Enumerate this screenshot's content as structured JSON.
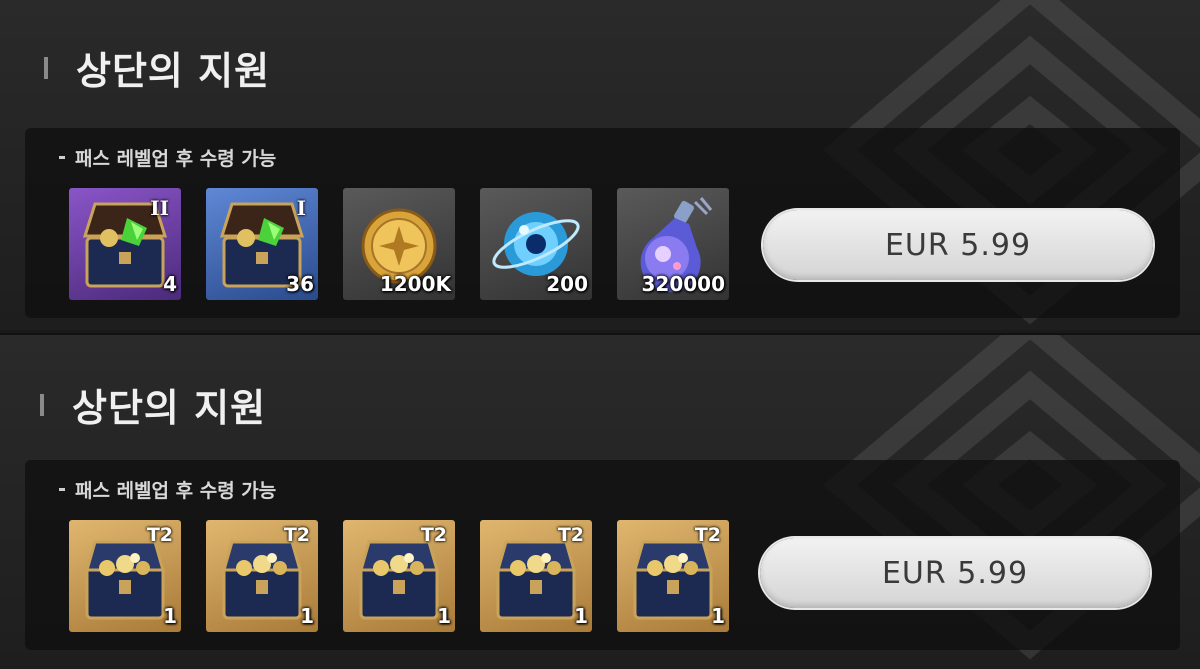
{
  "packs": [
    {
      "title": "상단의 지원",
      "note": "패스 레벨업 후 수령 가능",
      "price": "EUR 5.99",
      "items": [
        {
          "icon": "treasure-chest-icon",
          "tier": "II",
          "qty": "4",
          "bg": "purple"
        },
        {
          "icon": "treasure-chest-icon",
          "tier": "I",
          "qty": "36",
          "bg": "blue"
        },
        {
          "icon": "gold-coin-icon",
          "tier": "",
          "qty": "1200K",
          "bg": "gray"
        },
        {
          "icon": "blue-orb-icon",
          "tier": "",
          "qty": "200",
          "bg": "gray"
        },
        {
          "icon": "potion-flask-icon",
          "tier": "",
          "qty": "320000",
          "bg": "gray"
        }
      ]
    },
    {
      "title": "상단의 지원",
      "note": "패스 레벨업 후 수령 가능",
      "price": "EUR 5.99",
      "items": [
        {
          "icon": "treasure-chest-icon",
          "tier": "T2",
          "qty": "1",
          "bg": "gold"
        },
        {
          "icon": "treasure-chest-icon",
          "tier": "T2",
          "qty": "1",
          "bg": "gold"
        },
        {
          "icon": "treasure-chest-icon",
          "tier": "T2",
          "qty": "1",
          "bg": "gold"
        },
        {
          "icon": "treasure-chest-icon",
          "tier": "T2",
          "qty": "1",
          "bg": "gold"
        },
        {
          "icon": "treasure-chest-icon",
          "tier": "T2",
          "qty": "1",
          "bg": "gold"
        }
      ]
    }
  ],
  "colors": {
    "background": "#1a1a1a",
    "title": "#f0f0f0",
    "button": "#e6e6e6",
    "purple_item": "#8a55c8",
    "blue_item": "#5f88d6",
    "gold_item": "#e0b66f"
  }
}
